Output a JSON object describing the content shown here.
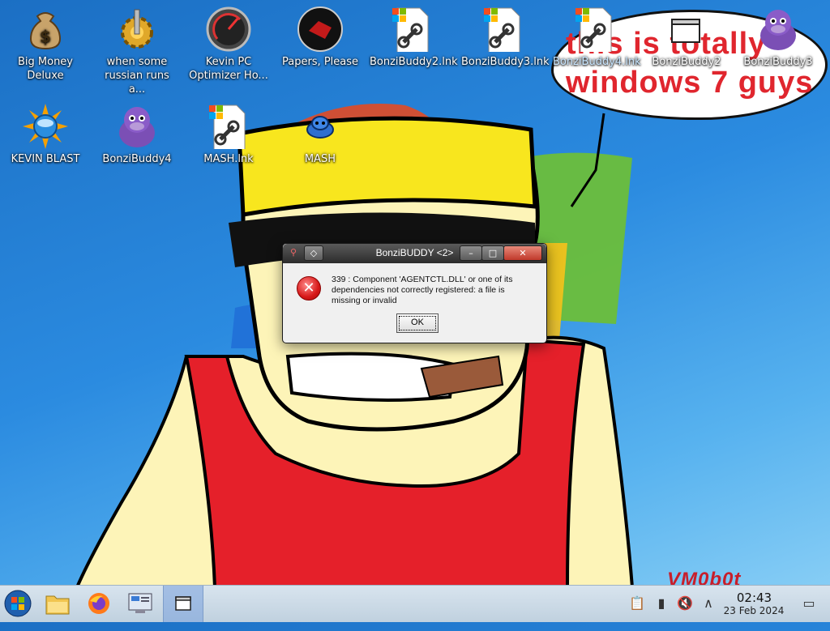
{
  "desktop": {
    "icons": [
      {
        "label": "Big Money Deluxe",
        "icon": "money-bag-icon"
      },
      {
        "label": "when some russian runs a...",
        "icon": "gear-icon"
      },
      {
        "label": "Kevin PC Optimizer Ho...",
        "icon": "gauge-icon"
      },
      {
        "label": "Papers, Please",
        "icon": "papers-please-icon"
      },
      {
        "label": "BonziBuddy2.lnk",
        "icon": "shortcut-file-icon"
      },
      {
        "label": "BonziBuddy3.lnk",
        "icon": "shortcut-file-icon"
      },
      {
        "label": "BonziBuddy4.lnk",
        "icon": "shortcut-file-icon"
      },
      {
        "label": "BonziBuddy2",
        "icon": "window-icon"
      },
      {
        "label": "BonziBuddy3",
        "icon": "purple-gorilla-icon"
      },
      {
        "label": "KEVIN BLAST",
        "icon": "sun-globe-icon"
      },
      {
        "label": "BonziBuddy4",
        "icon": "purple-gorilla-icon"
      },
      {
        "label": "MASH.lnk",
        "icon": "shortcut-file-icon"
      },
      {
        "label": "MASH",
        "icon": "blue-character-icon"
      }
    ]
  },
  "wallpaper": {
    "speech_text": "this is totally windows 7 guys",
    "signature": "VM0b0t"
  },
  "dialog": {
    "title": "BonziBUDDY <2>",
    "message": "339 : Component 'AGENTCTL.DLL' or one of its dependencies not correctly registered: a file is missing or invalid",
    "ok_label": "OK",
    "minimize_glyph": "–",
    "maximize_glyph": "□",
    "close_glyph": "✕",
    "error_glyph": "✕"
  },
  "taskbar": {
    "items": [
      "start-orb-icon",
      "file-manager-icon",
      "firefox-icon",
      "control-panel-icon",
      "window-icon"
    ],
    "clock_time": "02:43",
    "clock_date": "23 Feb 2024"
  },
  "colors": {
    "speech_text": "#e0262e",
    "taskbar": "#c8d7e4"
  }
}
